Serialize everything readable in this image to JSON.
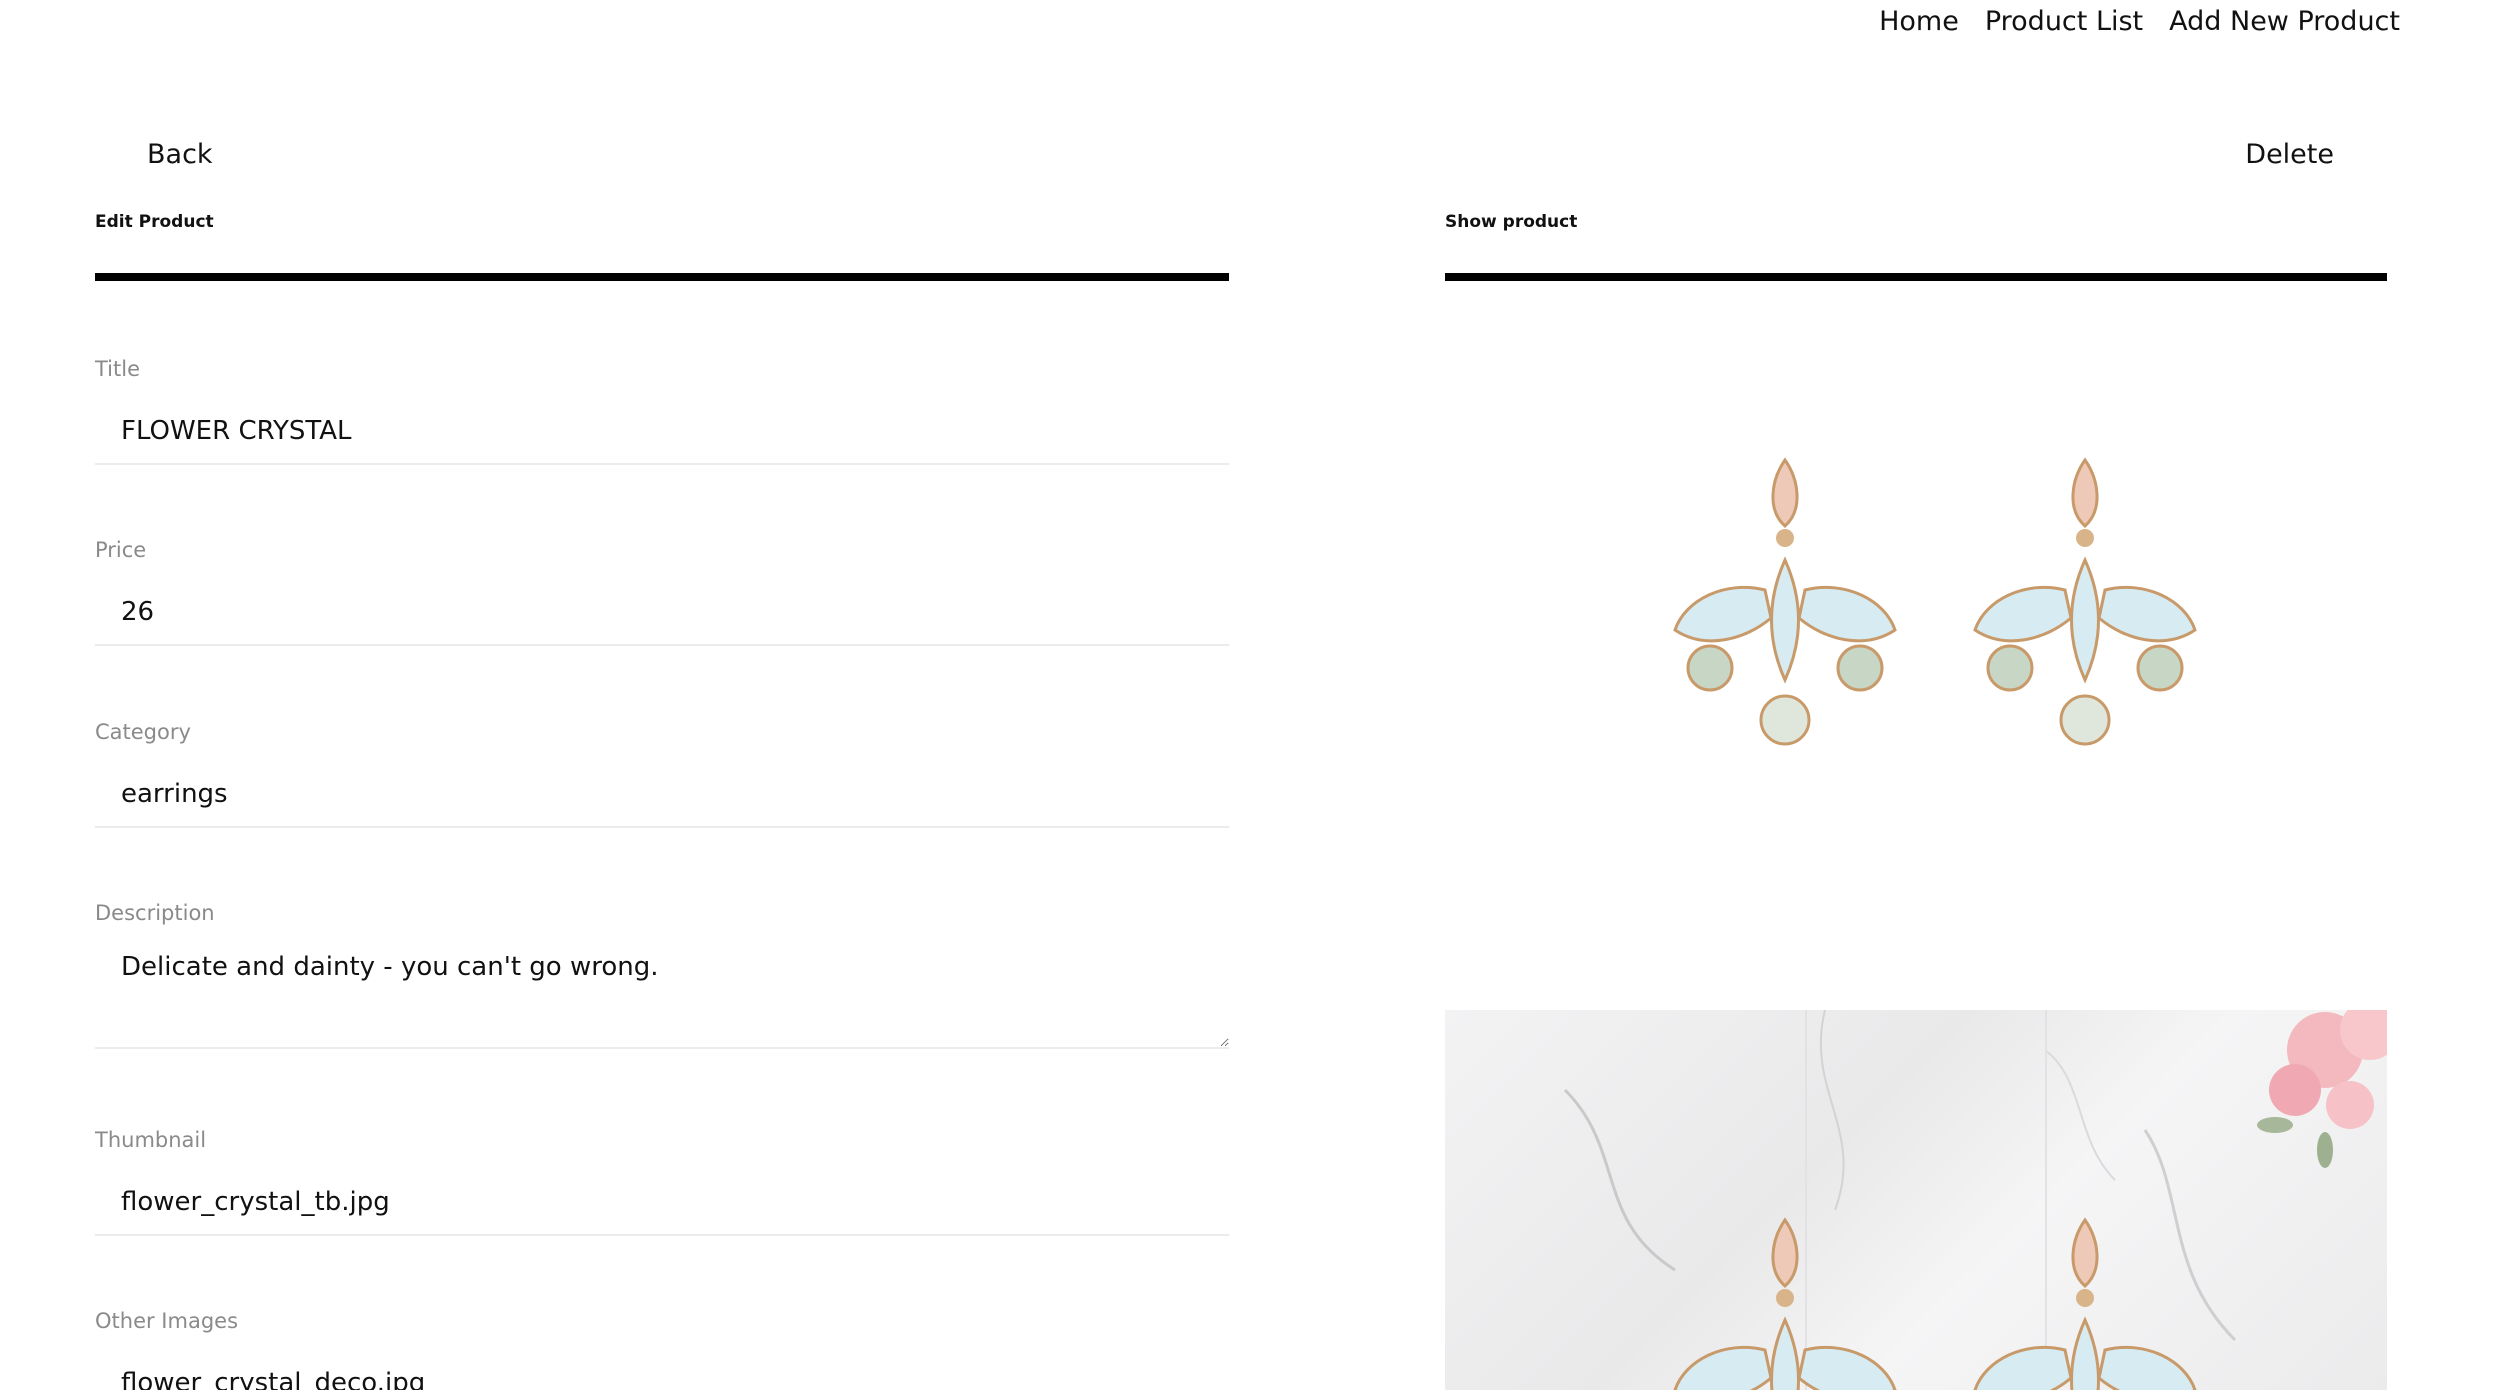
{
  "nav": {
    "items": [
      "Home",
      "Product List",
      "Add New Product"
    ]
  },
  "left": {
    "back_label": "Back",
    "section_title": "Edit Product",
    "fields": {
      "title": {
        "label": "Title",
        "value": "FLOWER CRYSTAL"
      },
      "price": {
        "label": "Price",
        "value": "26"
      },
      "category": {
        "label": "Category",
        "value": "earrings"
      },
      "description": {
        "label": "Description",
        "value": "Delicate and dainty - you can't go wrong."
      },
      "thumbnail": {
        "label": "Thumbnail",
        "value": "flower_crystal_tb.jpg"
      },
      "other_images": {
        "label": "Other Images",
        "value": "flower_crystal_deco.jpg"
      }
    }
  },
  "right": {
    "delete_label": "Delete",
    "section_title": "Show product"
  },
  "colors": {
    "rule": "#000000",
    "label": "#8a8a8a",
    "field_line": "#ececec",
    "crystal_blue": "#d9ecf4",
    "crystal_pink": "#f1c9b8",
    "crystal_green": "#c8d6c6",
    "gold": "#c89a6a"
  }
}
